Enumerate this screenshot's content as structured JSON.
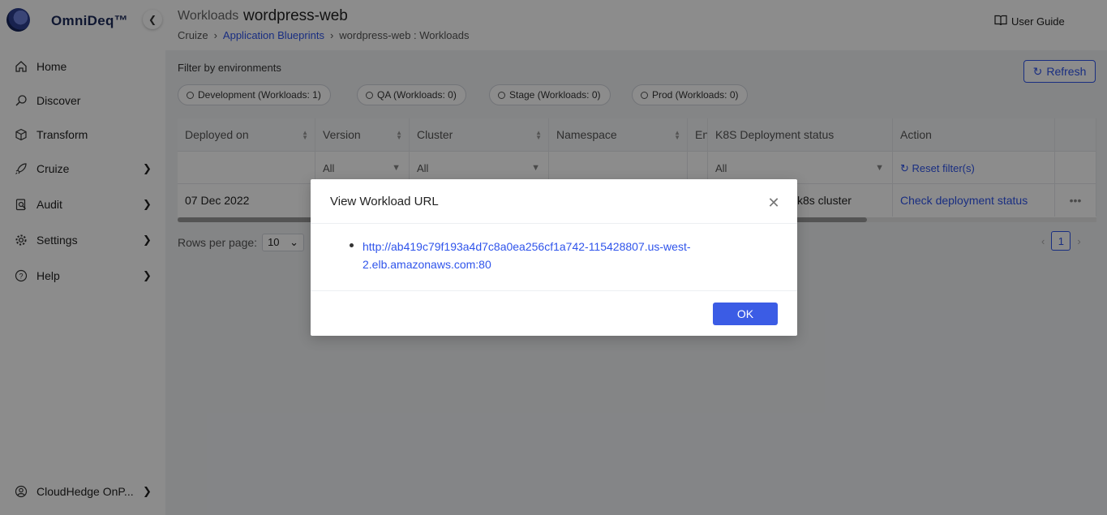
{
  "brand": {
    "name": "OmniDeq™"
  },
  "sidebar": {
    "items": [
      {
        "label": "Home",
        "icon": "home-icon",
        "has_children": false
      },
      {
        "label": "Discover",
        "icon": "discover-icon",
        "has_children": false
      },
      {
        "label": "Transform",
        "icon": "cube-icon",
        "has_children": false
      },
      {
        "label": "Cruize",
        "icon": "rocket-icon",
        "has_children": true
      },
      {
        "label": "Audit",
        "icon": "audit-icon",
        "has_children": true
      },
      {
        "label": "Settings",
        "icon": "gear-icon",
        "has_children": true
      },
      {
        "label": "Help",
        "icon": "help-icon",
        "has_children": true
      }
    ],
    "account": {
      "label": "CloudHedge OnP...",
      "icon": "user-icon"
    }
  },
  "header": {
    "section": "Workloads",
    "title": "wordpress-web",
    "breadcrumb": [
      "Cruize",
      "Application Blueprints",
      "wordpress-web : Workloads"
    ],
    "user_guide": "User Guide"
  },
  "filters": {
    "title": "Filter by environments",
    "refresh_label": "Refresh",
    "environments": [
      "Development (Workloads: 1)",
      "QA (Workloads: 0)",
      "Stage (Workloads: 0)",
      "Prod (Workloads: 0)"
    ]
  },
  "table": {
    "columns": [
      "Deployed on",
      "Version",
      "Cluster",
      "Namespace",
      "En",
      "K8S Deployment status",
      "Action"
    ],
    "filters": {
      "version": "All",
      "cluster": "All",
      "k8s_status": "All",
      "reset": "Reset filter(s)"
    },
    "rows": [
      {
        "deployed_on": "07 Dec 2022",
        "k8s_status": "k8s cluster",
        "action": "Check deployment status"
      }
    ],
    "more": "•••"
  },
  "pagination": {
    "rows_label": "Rows per page:",
    "rows_value": "10",
    "current_page": "1"
  },
  "modal": {
    "title": "View Workload URL",
    "url_line1": "http://ab419c79f193a4d7c8a0ea256cf1a742-115428807.us-west-",
    "url_line2": "2.elb.amazonaws.com:80",
    "ok_label": "OK"
  }
}
